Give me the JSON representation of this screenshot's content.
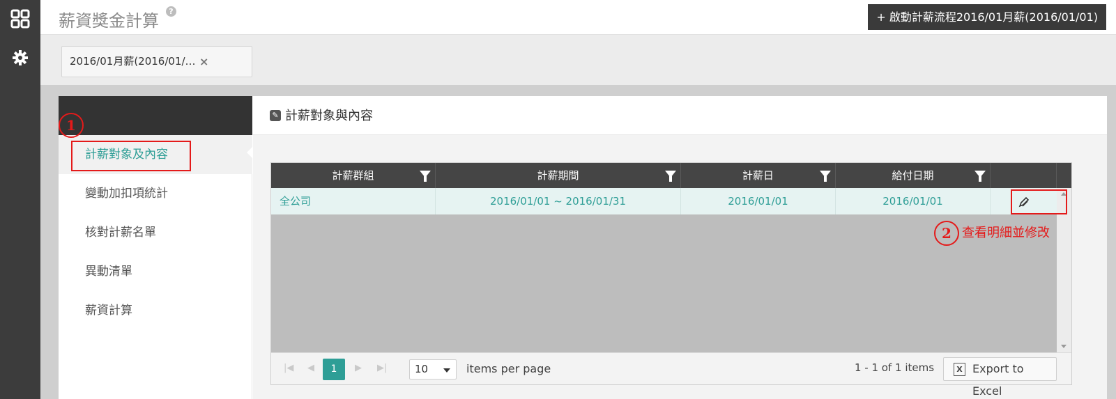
{
  "app": {
    "title": "薪資獎金計算",
    "help_icon": "?",
    "start_button": "+ 啟動計薪流程2016/01月薪(2016/01/01)"
  },
  "tab_chip": {
    "label": "2016/01月薪(2016/01/…",
    "close": "×"
  },
  "sidebar": {
    "items": [
      {
        "label": "計薪對象及內容",
        "active": true
      },
      {
        "label": "變動加扣項統計"
      },
      {
        "label": "核對計薪名單"
      },
      {
        "label": "異動清單"
      },
      {
        "label": "薪資計算"
      }
    ]
  },
  "content": {
    "title": "計薪對象與內容"
  },
  "grid": {
    "columns": [
      "計薪群組",
      "計薪期間",
      "計薪日",
      "給付日期"
    ],
    "rows": [
      {
        "group": "全公司",
        "period": "2016/01/01 ~ 2016/01/31",
        "pay_day": "2016/01/01",
        "payment_date": "2016/01/01"
      }
    ]
  },
  "pager": {
    "current_page": "1",
    "page_size": "10",
    "items_per_page_label": "items per page",
    "info": "1 - 1 of 1 items",
    "export_label": "Export to Excel"
  },
  "annotations": {
    "marker1": "1",
    "marker2": "2",
    "note2": "查看明細並修改"
  },
  "colors": {
    "accent": "#2e9e96",
    "annotation_red": "#e41a1a",
    "dark": "#3c3c3c"
  },
  "icons": [
    "apps-grid-icon",
    "gear-icon",
    "help-icon",
    "close-icon",
    "edit-icon",
    "filter-icon",
    "pencil-icon",
    "excel-icon",
    "first-page-icon",
    "prev-page-icon",
    "next-page-icon",
    "last-page-icon"
  ]
}
